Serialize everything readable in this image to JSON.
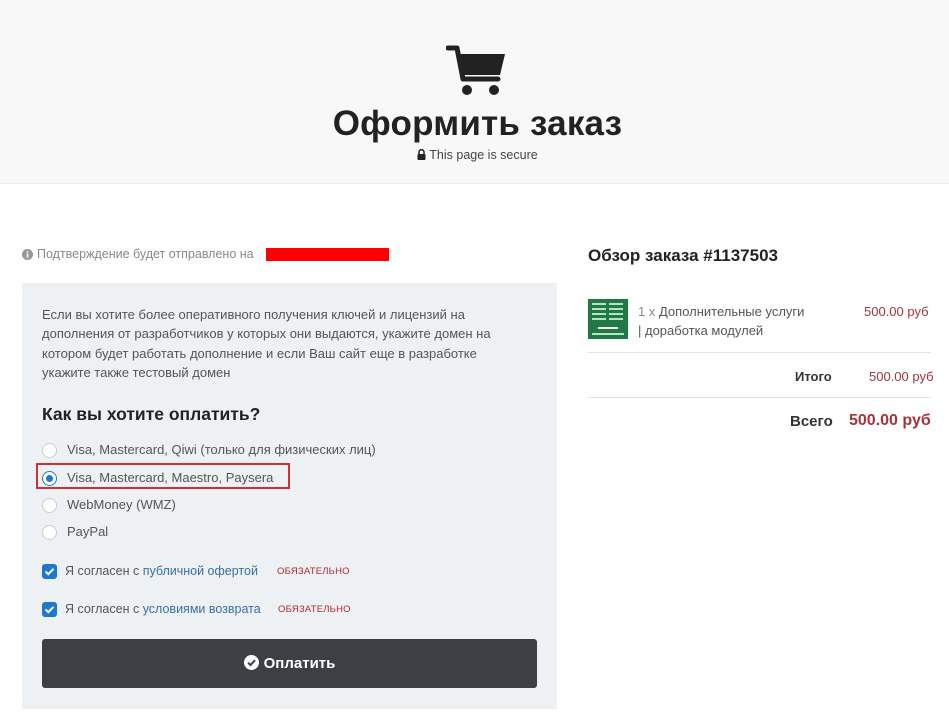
{
  "header": {
    "title": "Оформить заказ",
    "secure_text": "This page is secure"
  },
  "confirmation": {
    "text": "Подтверждение будет отправлено на"
  },
  "form": {
    "info_text": "Если вы хотите более оперативного получения ключей и лицензий на дополнения от разработчиков у которых они выдаются, укажите домен на котором будет работать дополнение и если Ваш сайт еще в разработке укажите также тестовый домен",
    "payment_heading": "Как вы хотите оплатить?",
    "payment_options": [
      {
        "label": "Visa, Mastercard, Qiwi (только для физических лиц)",
        "selected": false
      },
      {
        "label": "Visa, Mastercard, Maestro, Paysera",
        "selected": true
      },
      {
        "label": "WebMoney (WMZ)",
        "selected": false
      },
      {
        "label": "PayPal",
        "selected": false
      }
    ],
    "agreements": [
      {
        "prefix": "Я согласен с",
        "link": "публичной офертой",
        "required": "ОБЯЗАТЕЛЬНО",
        "checked": true
      },
      {
        "prefix": "Я согласен с",
        "link": "условиями возврата",
        "required": "ОБЯЗАТЕЛЬНО",
        "checked": true
      }
    ],
    "pay_button_label": "Оплатить"
  },
  "order": {
    "title": "Обзор заказа #1137503",
    "item": {
      "quantity": "1 x",
      "name": "Дополнительные услуги",
      "option": "| доработка модулей",
      "price": "500.00 руб"
    },
    "subtotal_label": "Итого",
    "subtotal_value": "500.00 руб",
    "total_label": "Всего",
    "total_value": "500.00 руб"
  },
  "colors": {
    "accent": "#1e78d2",
    "price": "#a6343a",
    "button": "#3c3f44",
    "highlight": "#d32f2f",
    "redaction": "#ff0000"
  },
  "icons": [
    "shopping-cart-icon",
    "lock-icon",
    "info-icon",
    "check-circle-icon",
    "checkbox-check-icon"
  ]
}
